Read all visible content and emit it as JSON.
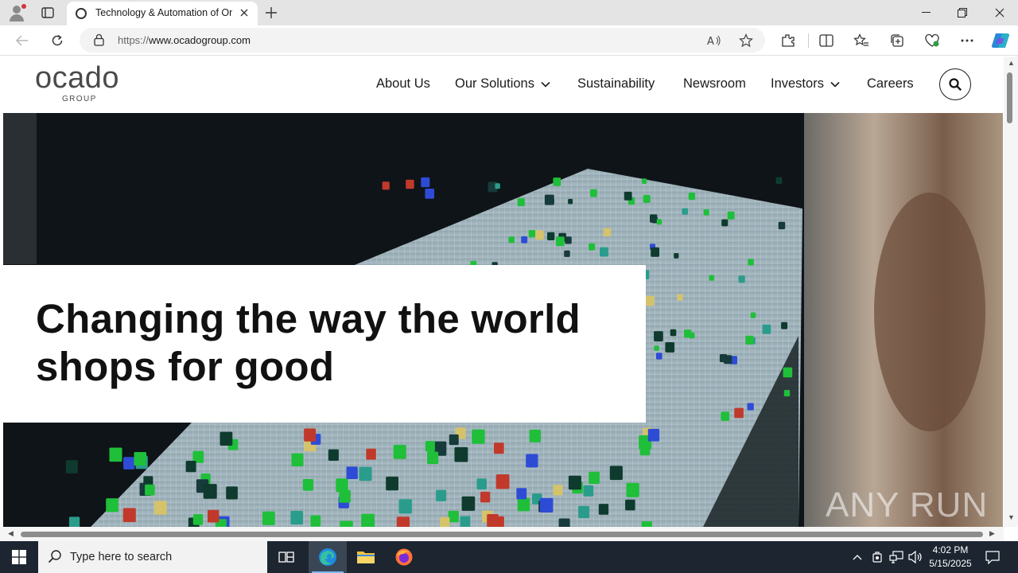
{
  "browser": {
    "tab": {
      "title": "Technology & Automation of Online Grocery | Ocado Group"
    },
    "address": {
      "prefix": "https://",
      "host": "www.ocadogroup.com"
    }
  },
  "site": {
    "logo": {
      "word": "ocado",
      "sub": "GROUP"
    },
    "nav": [
      {
        "label": "About Us",
        "dropdown": false
      },
      {
        "label": "Our Solutions",
        "dropdown": true
      },
      {
        "label": "Sustainability",
        "dropdown": false
      },
      {
        "label": "Newsroom",
        "dropdown": false
      },
      {
        "label": "Investors",
        "dropdown": true
      },
      {
        "label": "Careers",
        "dropdown": false
      }
    ],
    "hero": {
      "title_line1": "Changing the way the world",
      "title_line2": "shops for good"
    },
    "watermark": "ANY RUN"
  },
  "taskbar": {
    "search_placeholder": "Type here to search",
    "time": "4:02 PM",
    "date": "5/15/2025"
  }
}
